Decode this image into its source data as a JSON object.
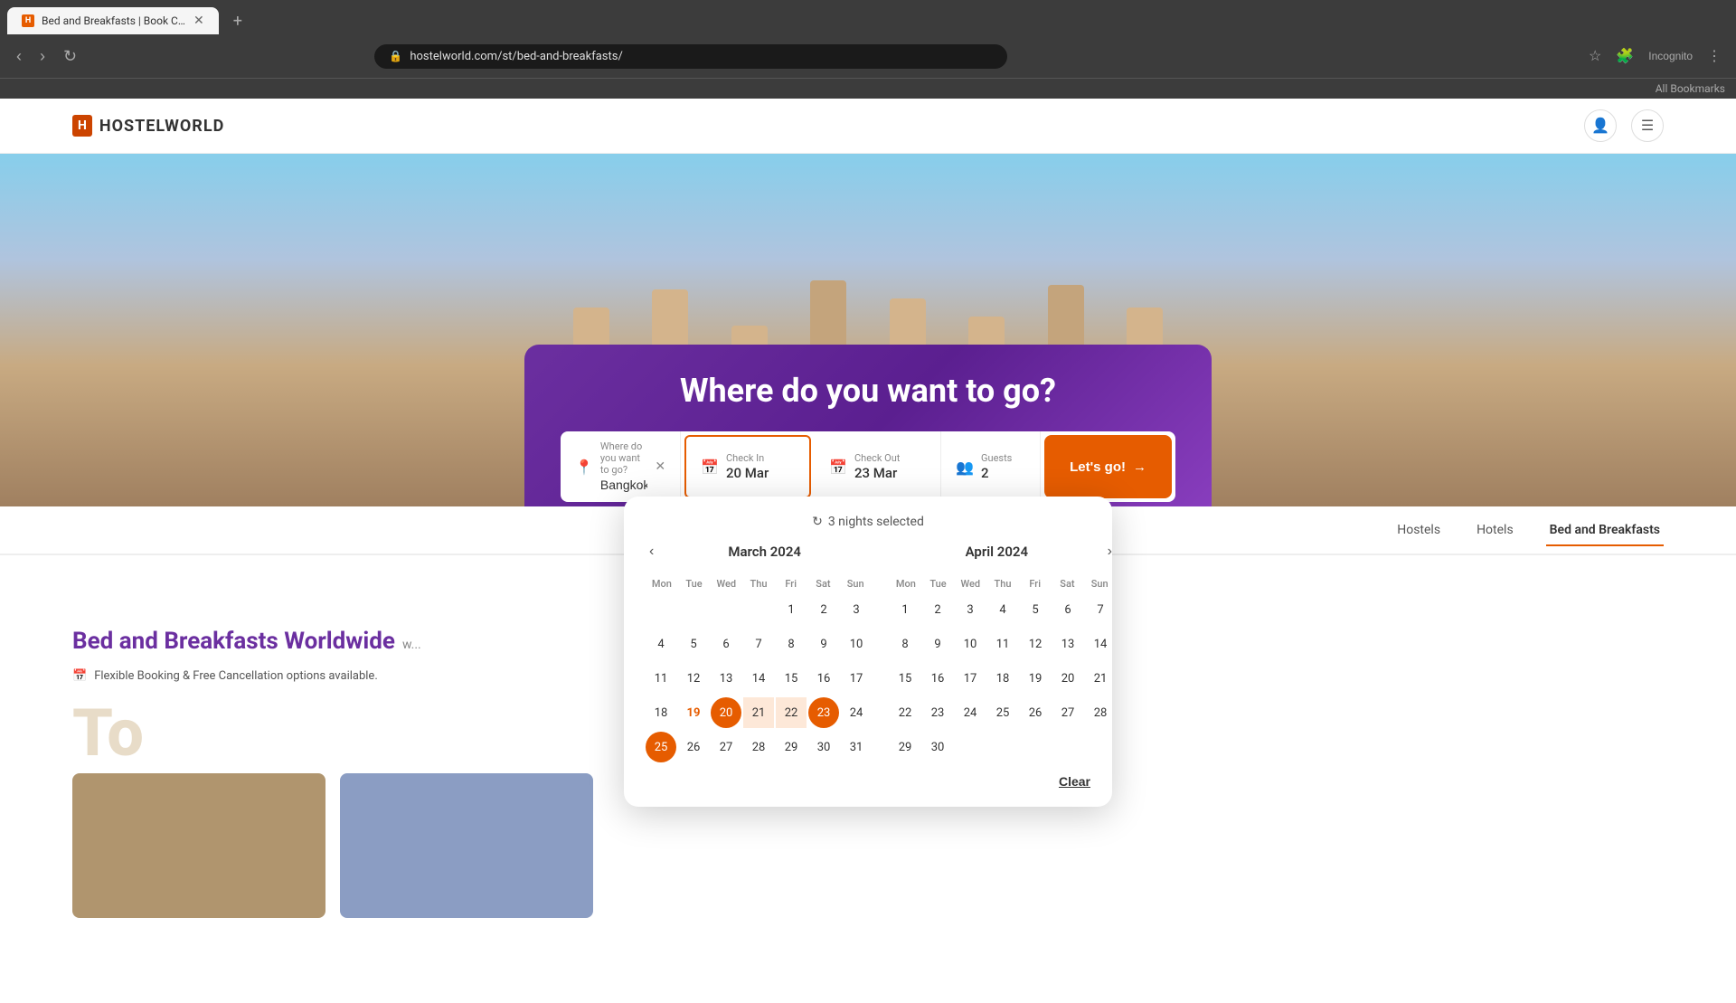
{
  "browser": {
    "tab_title": "Bed and Breakfasts | Book Che...",
    "tab_favicon": "H",
    "url": "hostelworld.com/st/bed-and-breakfasts/",
    "bookmarks_label": "All Bookmarks",
    "profile_label": "Incognito"
  },
  "header": {
    "logo_box": "H",
    "logo_text": "HOSTELWORLD",
    "user_icon": "👤",
    "menu_icon": "☰"
  },
  "hero": {
    "search_title": "Where do you want to go?",
    "destination_placeholder": "Where do you want to go?",
    "destination_value": "Bangkok, Thailand",
    "checkin_label": "Check In",
    "checkin_value": "20 Mar",
    "checkout_label": "Check Out",
    "checkout_value": "23 Mar",
    "guests_label": "Guests",
    "guests_value": "2",
    "cta_label": "Let's go!",
    "cta_icon": "→"
  },
  "calendar": {
    "nights_selected": "3 nights selected",
    "nights_icon": "↻",
    "march_title": "March 2024",
    "april_title": "April 2024",
    "day_names": [
      "Mon",
      "Tue",
      "Wed",
      "Thu",
      "Fri",
      "Sat",
      "Sun"
    ],
    "march_weeks": [
      [
        "",
        "",
        "",
        "",
        "1",
        "2",
        "3"
      ],
      [
        "4",
        "5",
        "6",
        "7",
        "8",
        "9",
        "10"
      ],
      [
        "11",
        "12",
        "13",
        "14",
        "15",
        "16",
        "17"
      ],
      [
        "18",
        "19",
        "20",
        "21",
        "22",
        "23",
        "24"
      ],
      [
        "25",
        "26",
        "27",
        "28",
        "29",
        "30",
        "31"
      ]
    ],
    "april_weeks": [
      [
        "1",
        "2",
        "3",
        "4",
        "5",
        "6",
        "7"
      ],
      [
        "8",
        "9",
        "10",
        "11",
        "12",
        "13",
        "14"
      ],
      [
        "15",
        "16",
        "17",
        "18",
        "19",
        "20",
        "21"
      ],
      [
        "22",
        "23",
        "24",
        "25",
        "26",
        "27",
        "28"
      ],
      [
        "29",
        "30",
        "",
        "",
        "",
        "",
        ""
      ]
    ],
    "clear_label": "Clear",
    "prev_icon": "‹",
    "next_icon": "›"
  },
  "content": {
    "section_title_plain": "Bed and Breakfasts ",
    "section_title_highlight": "Worldwide",
    "flexible_text": "Flexible Booking & Free Cancellation options available.",
    "to_title": "To"
  },
  "nav_tabs": [
    {
      "label": "Hostels",
      "active": false
    },
    {
      "label": "Hotels",
      "active": false
    },
    {
      "label": "Bed and Breakfasts",
      "active": true
    }
  ]
}
